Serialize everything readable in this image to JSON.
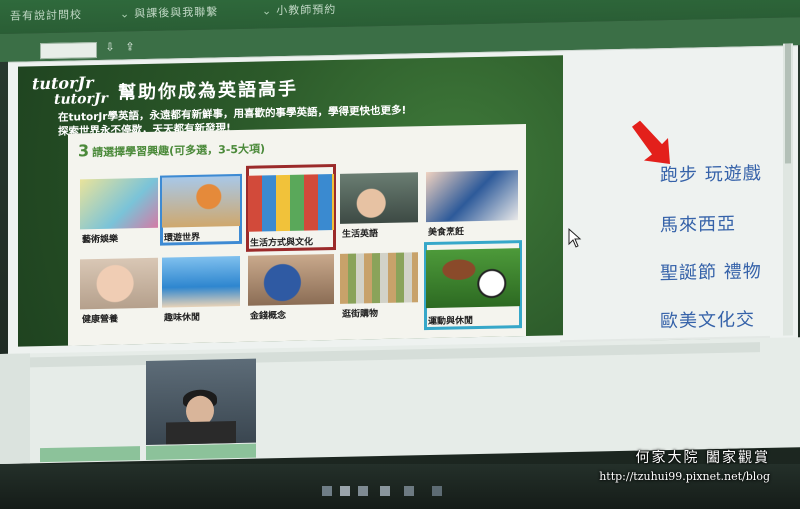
{
  "browser": {
    "tabs": [
      "吾有說討問校",
      "與課後與我聯繫",
      "小教師預約"
    ]
  },
  "lesson": {
    "logo_top": "tutorJr",
    "logo_bottom": "tutorJr",
    "title": "幫助你成為英語高手",
    "subtitle_line1": "在tutorJr學英語，永遠都有新鮮事，用喜歡的事學英語，學得更快也更多!",
    "subtitle_line2": "探索世界永不停歇，天天都有新發現!",
    "panel_hint_num": "3",
    "panel_hint": "請選擇學習興趣(可多選，3-5大項)",
    "tiles": [
      {
        "label": "藝術娛樂"
      },
      {
        "label": "環遊世界"
      },
      {
        "label": "生活方式與文化"
      },
      {
        "label": "生活英語"
      },
      {
        "label": "美食烹飪"
      },
      {
        "label": "健康營養"
      },
      {
        "label": "趣味休閒"
      },
      {
        "label": "金錢概念"
      },
      {
        "label": "逛街購物"
      },
      {
        "label": "運動與休閒"
      }
    ]
  },
  "topic_links": [
    "跑步 玩遊戲",
    "馬來西亞",
    "聖誕節 禮物",
    "歐美文化交"
  ],
  "watermark": {
    "name": "何家大院 闔家觀賞",
    "url": "http://tzuhui99.pixnet.net/blog"
  },
  "colors": {
    "link": "#3562a9",
    "arrow": "#e3201b",
    "select_blue": "#3d8ad3",
    "select_red": "#9b2a2a",
    "select_teal": "#36a7c9"
  }
}
